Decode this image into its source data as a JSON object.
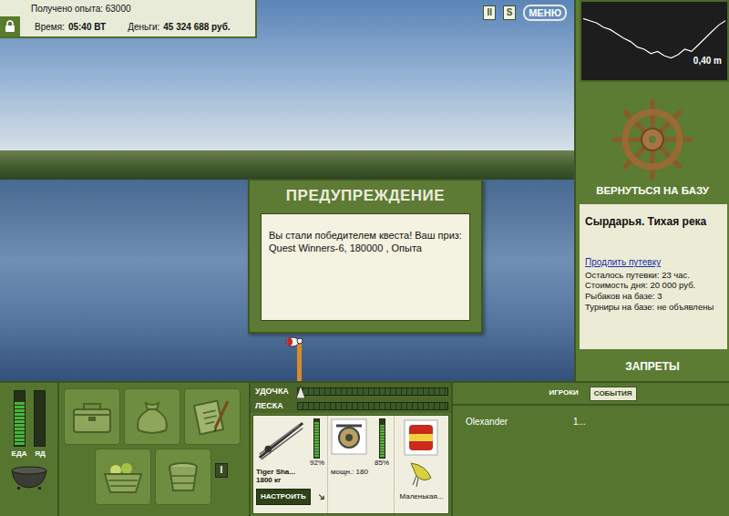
{
  "hud": {
    "experience": "Получено опыта: 63000",
    "time_label": "Время:",
    "time": "05:40 ВТ",
    "money_label": "Деньги:",
    "money": "45 324 688 руб."
  },
  "top_buttons": [
    {
      "label": "II",
      "kind": "box"
    },
    {
      "label": "S",
      "kind": "box"
    },
    {
      "label": "МЕНЮ",
      "kind": "menu"
    }
  ],
  "dialog": {
    "title": "ПРЕДУПРЕЖДЕНИЕ",
    "message": "Вы стали победителем квеста! Ваш приз: Quest Winners-6, 180000 , Опыта"
  },
  "depth": {
    "reading": "0,40 m",
    "profile": [
      0.12,
      0.14,
      0.16,
      0.2,
      0.22,
      0.26,
      0.3,
      0.33,
      0.38,
      0.4,
      0.44,
      0.42,
      0.46,
      0.48,
      0.45,
      0.4,
      0.42,
      0.36,
      0.3,
      0.24,
      0.18,
      0.14
    ]
  },
  "base": {
    "button": "ВЕРНУТЬСЯ НА БАЗУ",
    "location": "Сырдарья. Тихая река",
    "extend_link": "Продлить путевку",
    "info": [
      "Осталось путевки: 23 час.",
      "Стоимость дня: 20 000 руб.",
      "Рыбаков на базе: 3",
      "Турниры на базе: не объявлены"
    ],
    "bans": "ЗАПРЕТЫ"
  },
  "needs": [
    {
      "label": "ЕДА",
      "level": 0.8
    },
    {
      "label": "ЯД",
      "level": 0
    }
  ],
  "inventory_button": "I",
  "gauges": [
    {
      "label": "УДОЧКА",
      "level": 0
    },
    {
      "label": "ЛЕСКА",
      "level": 0
    }
  ],
  "tackle": {
    "rod": {
      "name": "Tiger Sha...",
      "weight": "1800 кг",
      "wear": "92%",
      "level": 0.92,
      "button": "НАСТРОИТЬ"
    },
    "reel": {
      "power": "мощн.: 180",
      "wear": "85%",
      "level": 0.85
    },
    "lure": {
      "name": "Маленькая..."
    }
  },
  "chat": {
    "tabs": [
      {
        "label": "ИГРОКИ",
        "selected": false
      },
      {
        "label": "СОБЫТИЯ",
        "selected": true
      }
    ],
    "rows": [
      {
        "player": "Olexander",
        "value": "1..."
      }
    ]
  }
}
